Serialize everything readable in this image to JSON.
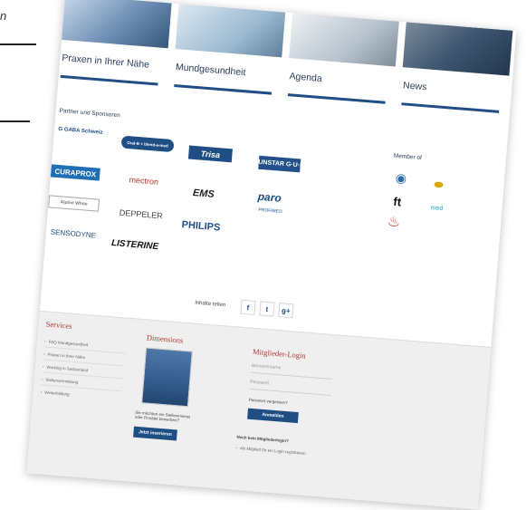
{
  "edge_fragment": {
    "word": "n"
  },
  "nav_tiles": [
    {
      "label": "Praxen in Ihrer Nähe"
    },
    {
      "label": "Mundgesundheit"
    },
    {
      "label": "Agenda"
    },
    {
      "label": "News"
    }
  ],
  "partners": {
    "title": "Partner und Sponsoren",
    "logos": [
      {
        "name": "G GABA Schweiz",
        "color": "#1f4e85"
      },
      {
        "name": "Oral-B + blend-a-med",
        "color": "#1f4e85"
      },
      {
        "name": "Trisa",
        "color": "#ffffff"
      },
      {
        "name": "SUNSTAR G·U·M",
        "color": "#ffffff"
      },
      {
        "name": "CURAPROX",
        "color": "#ffffff"
      },
      {
        "name": "mectron",
        "color": "#b5362e"
      },
      {
        "name": "EMS",
        "color": "#222222"
      },
      {
        "name": "paro",
        "color": "#1f4e85"
      },
      {
        "name": "PROFIMED",
        "color": "#5a8fc8"
      },
      {
        "name": "Alpine White",
        "color": "#777777"
      },
      {
        "name": "DEPPELER",
        "color": "#444444"
      },
      {
        "name": "PHILIPS",
        "color": "#1f4e85"
      },
      {
        "name": "SENSODYNE",
        "color": "#1f4e85"
      },
      {
        "name": "LISTERINE",
        "color": "#111111"
      }
    ]
  },
  "member": {
    "title": "Member of",
    "icons": [
      "globe-icon",
      "oval-badge-icon",
      "ft-icon",
      "med-icon",
      "tower-icon"
    ]
  },
  "share": {
    "label": "Inhalte teilen",
    "buttons": [
      {
        "icon": "facebook-icon",
        "glyph": "f"
      },
      {
        "icon": "twitter-icon",
        "glyph": "t"
      },
      {
        "icon": "googleplus-icon",
        "glyph": "g+"
      }
    ]
  },
  "footer": {
    "services": {
      "title": "Services",
      "links": [
        "FAQ Mundgesundheit",
        "Praxen in Ihrer Nähe",
        "Working in Switzerland",
        "Stellenvermittlung",
        "Weiterbildung"
      ]
    },
    "dimensions": {
      "title": "Dimensions",
      "text": "Sie möchten ein Stelleninserat oder Produkt bewerben?",
      "button": "Jetzt inserieren"
    },
    "login": {
      "title": "Mitglieder-Login",
      "username_placeholder": "Benutzername",
      "password_placeholder": "Passwort",
      "forgot": "Passwort vergessen?",
      "button": "Anmelden",
      "no_account": "Noch kein Mitgliederlogin?",
      "register": "Als Mitglied für ein Login registrieren"
    }
  }
}
